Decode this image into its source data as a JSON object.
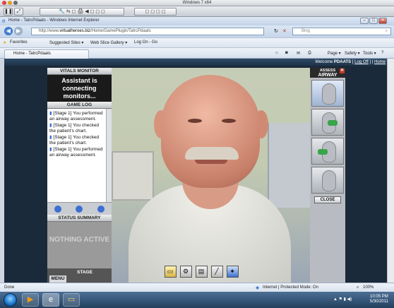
{
  "vm": {
    "title": "Windows 7 x64"
  },
  "ie": {
    "window_title": "Home - TatrcPdaats - Windows Internet Explorer",
    "url_prefix": "http://www.",
    "url_host": "virtualheroes.biz",
    "url_path": "/Home/GamePlugin/TatrcPdaats",
    "search_placeholder": "Bing",
    "favorites": {
      "favorites_label": "Favorites",
      "suggested_sites": "Suggested Sites ▾",
      "web_slice_gallery": "Web Slice Gallery ▾",
      "log_on": "Log On - Go"
    },
    "tab_title": "Home - TatrcPdaats",
    "commands": {
      "page": "Page ▾",
      "safety": "Safety ▾",
      "tools": "Tools ▾"
    },
    "status": {
      "left": "Done",
      "zone": "Internet | Protected Mode: On",
      "zoom": "100%"
    }
  },
  "page": {
    "welcome_prefix": "Welcome ",
    "user": "PDAATS",
    "logoff": "Log Off",
    "home": "Home"
  },
  "left_panel": {
    "vitals_title": "VITALS MONITOR",
    "vitals_message": "Assistant is connecting monitors...",
    "gamelog_title": "GAME LOG",
    "log_entries": [
      "[Stage 1] You performed an airway assessment.",
      "[Stage 1] You checked the patient's chart.",
      "[Stage 1] You checked the patient's chart.",
      "[Stage 1] You performed an airway assessment."
    ],
    "status_title": "STATUS SUMMARY",
    "status_message": "NOTHING ACTIVE",
    "menu_label": "MENU",
    "stage_label": "STAGE"
  },
  "right_panel": {
    "header_top": "ASSESS",
    "header_main": "AIRWAY",
    "close_label": "CLOSE"
  },
  "toolbar_icons": [
    "folder-icon",
    "tools-icon",
    "chart-icon",
    "syringe-icon",
    "equipment-icon"
  ],
  "taskbar": {
    "time": "10:05 PM",
    "date": "5/30/2011"
  }
}
